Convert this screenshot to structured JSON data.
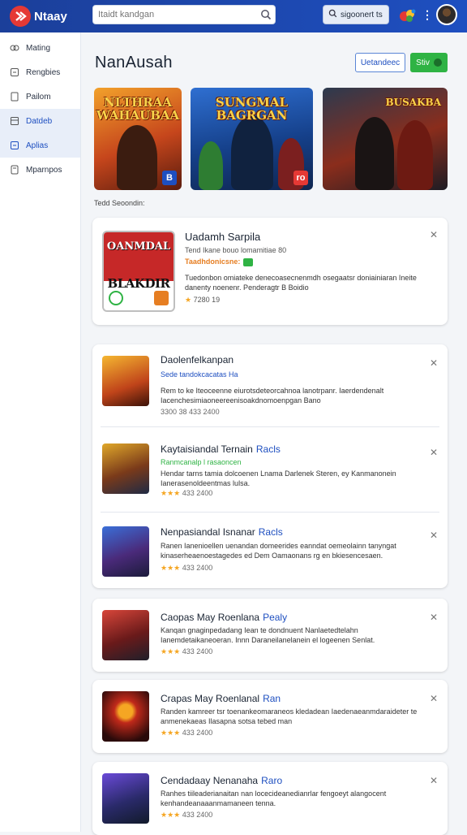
{
  "topbar": {
    "logo_text": "Ntaay",
    "search_placeholder": "Itaidt kandgan",
    "button_label": "sigoonert ts"
  },
  "sidebar": {
    "items": [
      {
        "label": "Mating",
        "icon": "link-icon"
      },
      {
        "label": "Rengbies",
        "icon": "box-icon"
      },
      {
        "label": "Pailom",
        "icon": "doc-icon"
      },
      {
        "label": "Datdeb",
        "icon": "grid-icon",
        "active": true
      },
      {
        "label": "Aplias",
        "icon": "app-icon",
        "active": true
      },
      {
        "label": "Mparnpos",
        "icon": "file-icon"
      }
    ]
  },
  "main": {
    "title": "NanAusah",
    "outline_button": "Uetandeec",
    "green_button": "Stiv",
    "banners": [
      {
        "title": "NLTHRAA WAHAUBAA",
        "badge": "B"
      },
      {
        "title": "SUNGMAL BAGRGAN",
        "badge": "ro"
      },
      {
        "title": "BUSAKBA",
        "badge": ""
      }
    ],
    "section_label": "Tedd Seoondin:",
    "featured": {
      "name": "Uadamh Sarpila",
      "meta": "Tend Ikane bouo lomamitiae  80",
      "tag": "Taadhdonicsne:",
      "description": "Tuedonbon omiateke denecoasecnenmdh osegaatsr doniainiaran Ineite danenty noenenr. Penderagtr  B  Boidio",
      "rating": "7280  19",
      "thumb_title": "OANMDAL",
      "thumb_big": "BLAKDIR"
    },
    "list": [
      {
        "name": "Daolenfelkanpan",
        "badge": "",
        "meta": "Sede tandokcacatas Ha",
        "meta_color": "blue",
        "description": "Rem to ke Iteoceenne eiurotsdeteorcahnoa lanotrpanr. Iaerdendenalt Iacenchesimiaoneereenisoakdnomoenpgan Bano",
        "rating": "3300 38  433 2400",
        "stars": 0
      },
      {
        "name": "Kaytaisiandal Ternain",
        "badge": "Racls",
        "meta": "Ranmcanalp l rasaoncen",
        "meta_color": "green",
        "description": "Hendar tarns tamia dolcoenen Lnama Darlenek Steren, ey Kanmanonein Ianerasenoldeentmas lulsa.",
        "rating": "433 2400",
        "stars": 3
      },
      {
        "name": "Nenpasiandal Isnanar",
        "badge": "Racls",
        "meta": "",
        "meta_color": "green",
        "description": "Ranen Ianenioellen uenandan domeerides eanndat oemeolainn tanyngat kinaserheaenoestagedes ed Dem Oamaonans rg en bkiesencesaen.",
        "rating": "433 2400",
        "stars": 3
      },
      {
        "name": "Caopas May Roenlana",
        "badge": "Pealy",
        "meta": "",
        "meta_color": "green",
        "description": "Kanqan gnaginpedadang Iean te dondnuent Nanlaetedtelahn Ianemdetaikaneoeran. Innn Daraneilanelanein el logeenen Senlat.",
        "rating": "433 2400",
        "stars": 3
      },
      {
        "name": "Crapas May Roenlanal",
        "badge": "Ran",
        "meta": "",
        "meta_color": "green",
        "description": "Randen kamreer tsr toenankeomaraneos kledadean Iaedenaeanmdaraideter te anmenekaeas Ilasapna sotsa tebed man",
        "rating": "433 2400",
        "stars": 3
      },
      {
        "name": "Cendadaay Nenanaha",
        "badge": "Raro",
        "meta": "",
        "meta_color": "green",
        "description": "Ranhes tiileaderianaitan nan locecideanedianrlar fengoeyt alangocent kenhandeanaaanmamaneen tenna.",
        "rating": "433 2400",
        "stars": 3
      }
    ]
  }
}
